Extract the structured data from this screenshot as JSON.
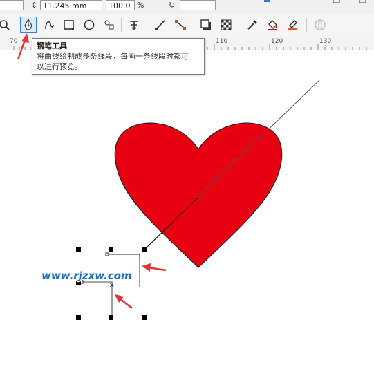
{
  "property_bar": {
    "height_value": "11.245 mm",
    "scale_value": "100.0",
    "percent_symbol": "%"
  },
  "tooltip": {
    "title": "钢笔工具",
    "line1": "将曲线绘制成多条线段，每画一条线段时都可",
    "line2": "以进行预览。"
  },
  "ruler": {
    "labels": [
      "70",
      "110",
      "120",
      "130"
    ]
  },
  "watermark": "www.rjzxw.com",
  "colors": {
    "heart_fill": "#e60012",
    "selection_accent": "#3c7fd6",
    "arrow": "#e63434"
  },
  "tools": [
    "zoom-tool-icon",
    "pen-tool-icon",
    "freehand-icon",
    "rectangle-icon",
    "ellipse-icon",
    "polygon-icon",
    "text-tool-icon",
    "line-tool-icon",
    "connector-icon",
    "shadow-icon",
    "transparency-icon",
    "eyedropper-icon",
    "fill-icon",
    "smart-fill-icon",
    "disabled-icon"
  ]
}
